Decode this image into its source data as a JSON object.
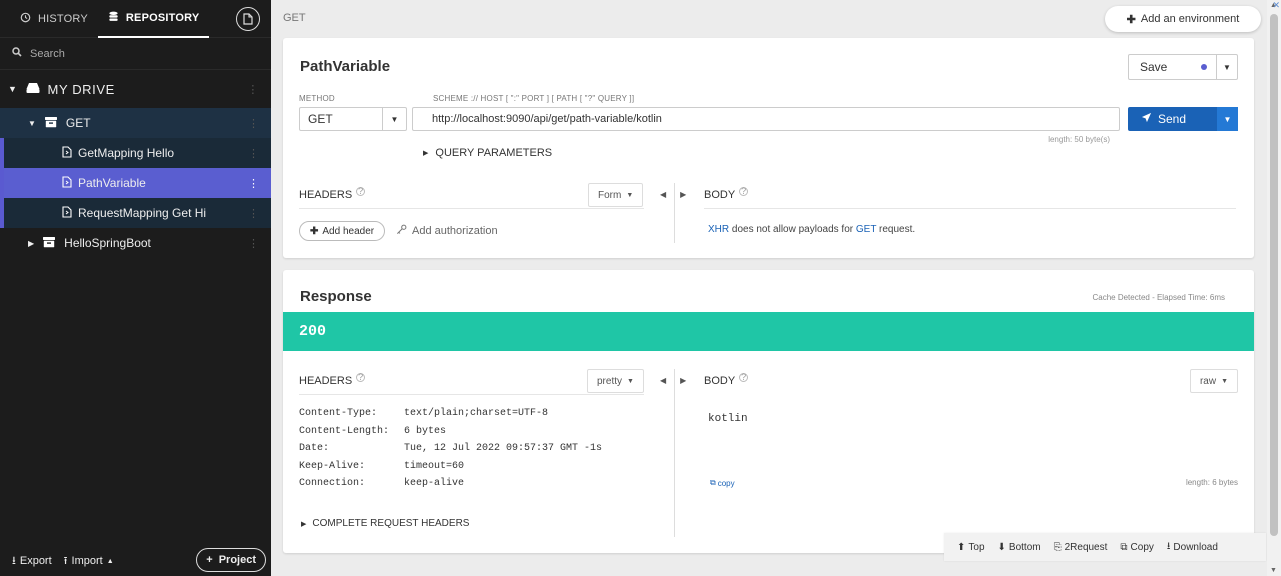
{
  "sidebar": {
    "tabs": {
      "history": "HISTORY",
      "repository": "REPOSITORY"
    },
    "search_placeholder": "Search",
    "drive_label": "MY DRIVE",
    "folder_get": "GET",
    "requests": [
      {
        "label": "GetMapping Hello"
      },
      {
        "label": "PathVariable"
      },
      {
        "label": "RequestMapping Get Hi"
      }
    ],
    "folder_other": "HelloSpringBoot",
    "bottom": {
      "export": "Export",
      "import": "Import",
      "project": "Project"
    }
  },
  "header": {
    "breadcrumb": "GET",
    "add_env": "Add an environment"
  },
  "request": {
    "title": "PathVariable",
    "save_label": "Save",
    "method_label": "METHOD",
    "method_value": "GET",
    "url_hint": "SCHEME :// HOST [ \":\" PORT ] [ PATH [ \"?\" QUERY ]]",
    "url_value": "http://localhost:9090/api/get/path-variable/kotlin",
    "url_length": "length: 50 byte(s)",
    "send_label": "Send",
    "query_params": "QUERY PARAMETERS",
    "headers_label": "HEADERS",
    "headers_mode": "Form",
    "body_label": "BODY",
    "add_header": "Add header",
    "add_auth": "Add authorization",
    "xhr_note": {
      "xhr": "XHR",
      "mid": " does not allow payloads for ",
      "get": "GET",
      "end": " request."
    }
  },
  "response": {
    "title": "Response",
    "elapsed": "Cache Detected - Elapsed Time: 6ms",
    "status_code": "200",
    "headers_label": "HEADERS",
    "headers_mode": "pretty",
    "body_label": "BODY",
    "body_mode": "raw",
    "headers": [
      {
        "key": "Content-Type:",
        "value": "text/plain;charset=UTF-8"
      },
      {
        "key": "Content-Length:",
        "value": "6 bytes"
      },
      {
        "key": "Date:",
        "value": "Tue, 12 Jul 2022 09:57:37 GMT -1s"
      },
      {
        "key": "Keep-Alive:",
        "value": "timeout=60"
      },
      {
        "key": "Connection:",
        "value": "keep-alive"
      }
    ],
    "body_value": "kotlin",
    "copy": "copy",
    "body_length": "length: 6 bytes",
    "complete_headers": "COMPLETE REQUEST HEADERS"
  },
  "bottom_bar": {
    "top": "Top",
    "bottom": "Bottom",
    "to_request": "2Request",
    "copy": "Copy",
    "download": "Download"
  },
  "colors": {
    "accent": "#5a5ed0",
    "send": "#1a62b6",
    "status_ok": "#1fc6a6",
    "sidebar_bg": "#1c1c1c"
  }
}
